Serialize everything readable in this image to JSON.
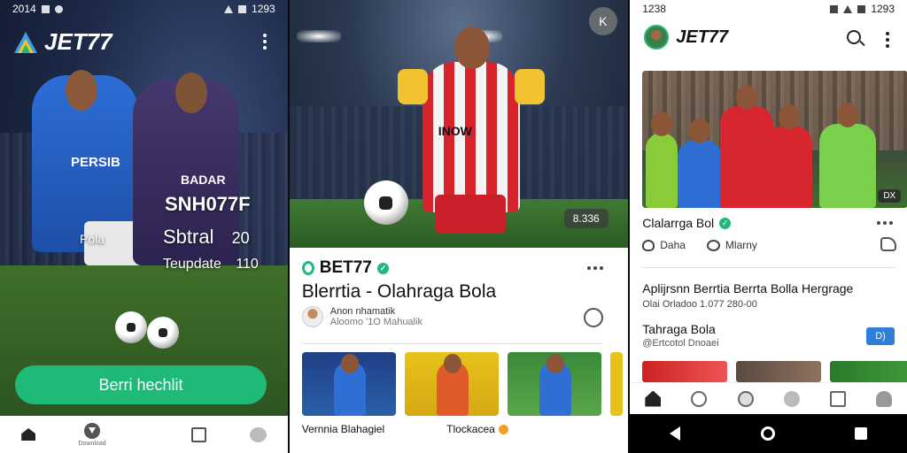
{
  "panel1": {
    "status_time": "2014",
    "status_right": "1293",
    "brand": "JET77",
    "jersey_blue": "PERSIB",
    "jersey_purple": "BADAR",
    "headline_line1": "SNH077F",
    "headline_line2_a": "Sbtral",
    "headline_line2_b": "20",
    "headline_line3": "Teupdate",
    "headline_line3_b": "110",
    "side_label": "Pola",
    "cta_label": "Berri hechlit",
    "nav_download_label": "Download",
    "accent_color": "#1fb978"
  },
  "panel2": {
    "close_label": "K",
    "video_chip": "8.336",
    "brand": "BET77",
    "title": "Blerrtia - Olahraga Bola",
    "author_name": "Anon nhamatik",
    "author_meta": "Aloomo '1O Mahualik",
    "jersey_text": "INOW",
    "captions": [
      {
        "text": "Vernnia Blahagiel",
        "dot": false
      },
      {
        "text": "Tlockacea",
        "dot": true
      }
    ]
  },
  "panel3": {
    "status_time": "1238",
    "status_right": "1293",
    "brand": "JET77",
    "duration_badge": "DX",
    "channel_name": "Clalarrga Bol",
    "actions": [
      {
        "icon": "heart-icon",
        "label": "Daha"
      },
      {
        "icon": "comment-icon",
        "label": "Mlarny"
      }
    ],
    "article_title": "Aplijrsnn Berrtia Berrta Bolla Hergrage",
    "article_meta": "Olai Orladoo 1.077 280-00",
    "sub_title": "Tahraga Bola",
    "sub_meta": "@Ertcotol Dnoaei",
    "tag": "D)"
  }
}
